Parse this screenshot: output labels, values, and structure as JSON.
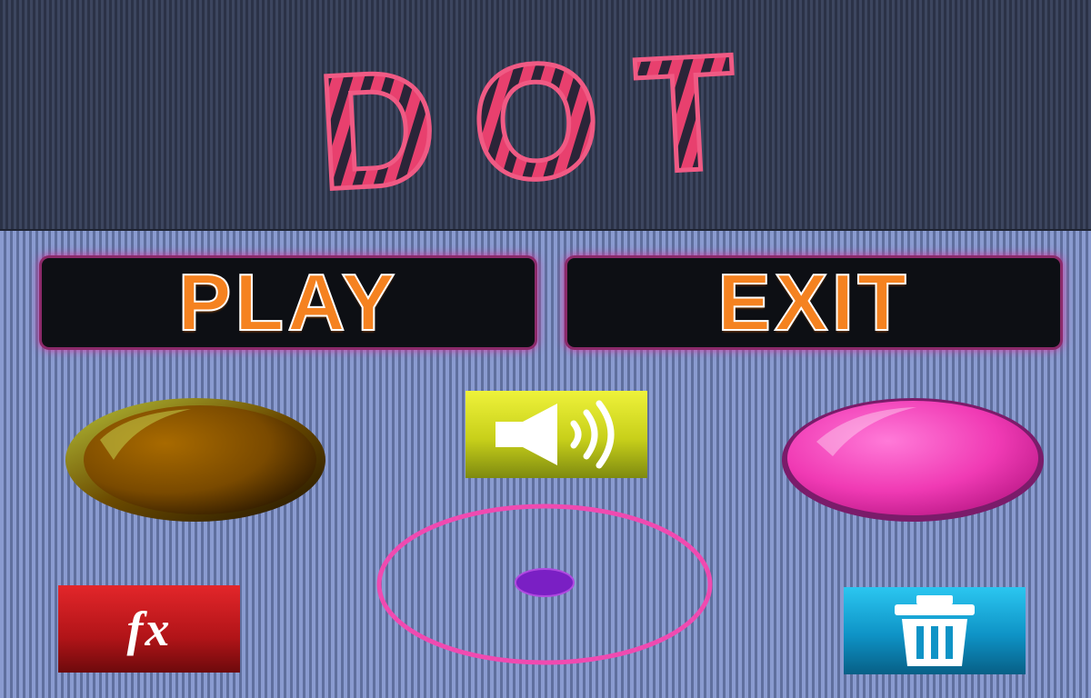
{
  "game": {
    "title": "DOT",
    "play_label": "PLAY",
    "exit_label": "EXIT",
    "fx_label": "fx"
  },
  "icons": {
    "sound": "speaker-volume-icon",
    "effects": "fx-icon",
    "delete": "trash-icon"
  },
  "colors": {
    "title_stroke": "#e8406e",
    "button_text": "#f58220",
    "button_glow": "#d03aa0",
    "left_disc": "#8a5200",
    "right_disc": "#f03ab4",
    "ring": "#f04ab0",
    "dot": "#7a1fc4",
    "sound_tile": "#d8e020",
    "fx_tile": "#c8181c",
    "trash_tile": "#14a8d8"
  }
}
